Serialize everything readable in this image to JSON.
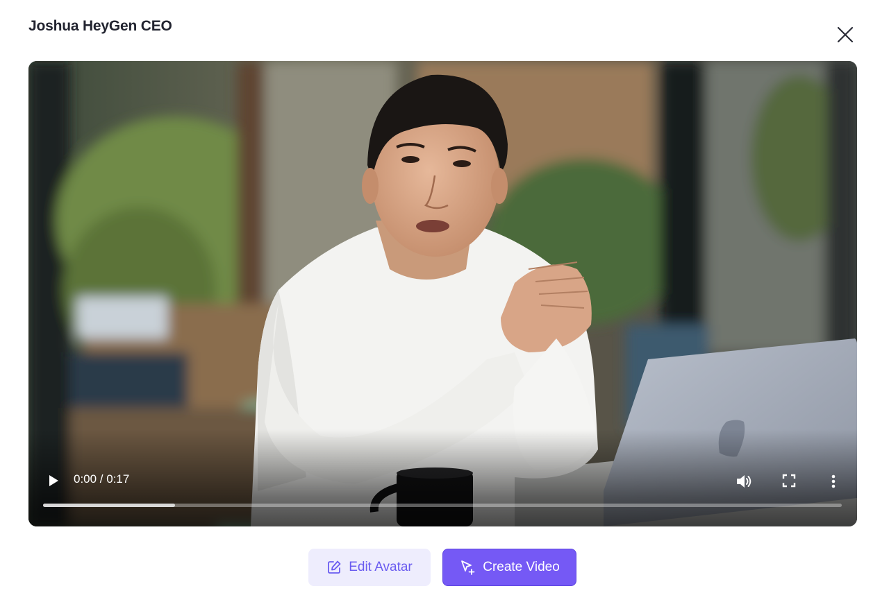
{
  "dialog": {
    "title": "Joshua HeyGen CEO",
    "close_icon": "close-icon"
  },
  "player": {
    "current_time": "0:00",
    "separator": "/",
    "duration": "0:17",
    "time_display": "0:00 / 0:17",
    "progress_fraction": 0.165,
    "icons": {
      "play": "play-icon",
      "volume": "volume-icon",
      "fullscreen": "fullscreen-icon",
      "more": "more-vertical-icon"
    }
  },
  "actions": {
    "edit_avatar_label": "Edit Avatar",
    "create_video_label": "Create Video",
    "edit_icon": "edit-icon",
    "create_icon": "cursor-add-icon"
  },
  "colors": {
    "accent": "#7559f5",
    "accent_light": "#eeedfd",
    "title_text": "#222430"
  }
}
